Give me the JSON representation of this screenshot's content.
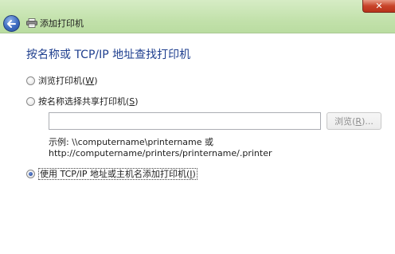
{
  "window": {
    "title": "添加打印机",
    "back_icon": "back-arrow-icon",
    "printer_icon": "printer-icon",
    "close_glyph": "✕",
    "colors": {
      "title_bar": "#c4e2ad",
      "heading": "#1f3f8f",
      "close_button": "#c8432a"
    }
  },
  "page": {
    "heading": "按名称或 TCP/IP 地址查找打印机",
    "options": [
      {
        "label": "浏览打印机",
        "accel": "W",
        "selected": false
      },
      {
        "label": "按名称选择共享打印机",
        "accel": "S",
        "selected": false
      },
      {
        "label": "使用 TCP/IP 地址或主机名添加打印机",
        "accel": "I",
        "selected": true
      }
    ],
    "share_input": {
      "value": "",
      "placeholder": ""
    },
    "browse_button": {
      "label": "浏览",
      "accel": "R",
      "ellipsis": "...",
      "enabled": false
    },
    "example_line1": "示例: \\\\computername\\printername 或",
    "example_line2": "http://computername/printers/printername/.printer"
  }
}
